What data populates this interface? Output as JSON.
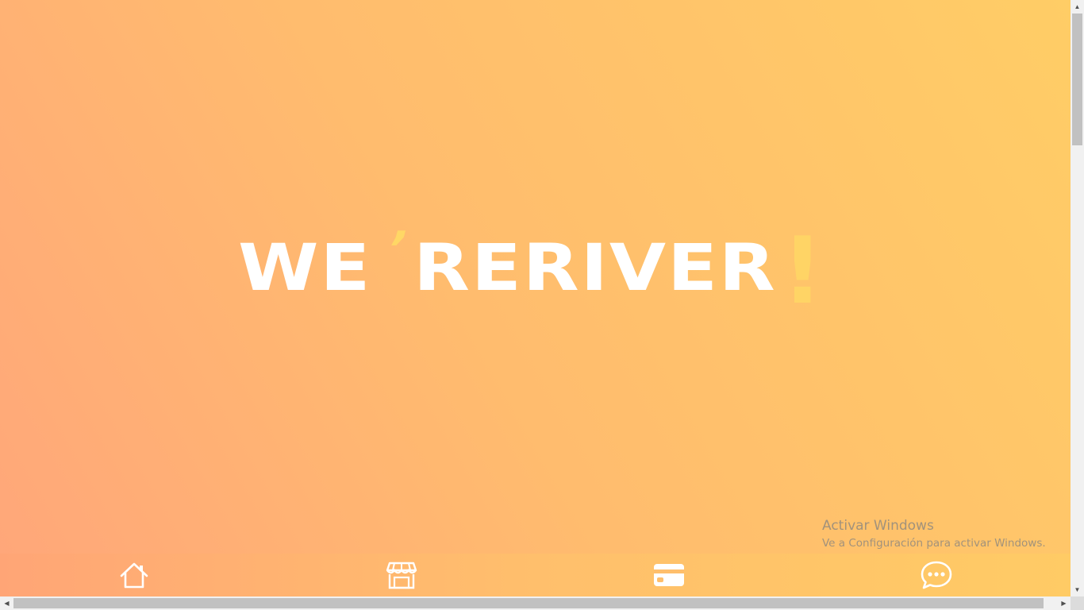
{
  "hero": {
    "brand_part1": "WE",
    "brand_apostrophe": "’",
    "brand_part2": "RERIVER",
    "brand_exclaim": "!"
  },
  "bottom_nav": {
    "items": [
      {
        "icon": "home-icon"
      },
      {
        "icon": "store-icon"
      },
      {
        "icon": "card-icon"
      },
      {
        "icon": "chat-icon"
      }
    ]
  },
  "watermark": {
    "title": "Activar Windows",
    "subtitle": "Ve a Configuración para activar Windows."
  },
  "scrollbar": {
    "up": "▲",
    "down": "▼",
    "left": "◀",
    "right": "▶"
  },
  "colors": {
    "gradient_start": "#ffa67a",
    "gradient_end": "#ffcd66",
    "accent_yellow": "#ffd765",
    "text_white": "#ffffff"
  }
}
